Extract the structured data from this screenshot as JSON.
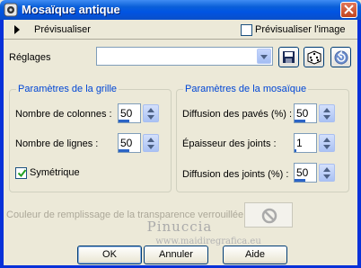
{
  "window": {
    "title": "Mosaïque antique"
  },
  "preview": {
    "label": "Prévisualiser",
    "checkbox_label": "Prévisualiser l'image",
    "checked": false
  },
  "presets": {
    "label": "Réglages",
    "value": ""
  },
  "grid_group": {
    "title": "Paramètres de la grille",
    "columns_label": "Nombre de colonnes :",
    "columns_value": "50",
    "rows_label": "Nombre de lignes :",
    "rows_value": "50",
    "symmetric_label": "Symétrique",
    "symmetric_checked": true
  },
  "mosaic_group": {
    "title": "Paramètres de la mosaïque",
    "tile_diffusion_label": "Diffusion des pavés (%) :",
    "tile_diffusion_value": "50",
    "joint_thickness_label": "Épaisseur des joints :",
    "joint_thickness_value": "1",
    "joint_diffusion_label": "Diffusion des joints (%) :",
    "joint_diffusion_value": "50"
  },
  "fill": {
    "label": "Couleur de remplissage de la transparence verrouillée :"
  },
  "watermark": {
    "name": "Pinuccia",
    "url": "www.maidiregrafica.eu"
  },
  "buttons": {
    "ok": "OK",
    "cancel": "Annuler",
    "help": "Aide"
  },
  "colors": {
    "title_bar": "#0054e3",
    "group_title": "#0046d5",
    "dialog_bg": "#ece9d8"
  }
}
